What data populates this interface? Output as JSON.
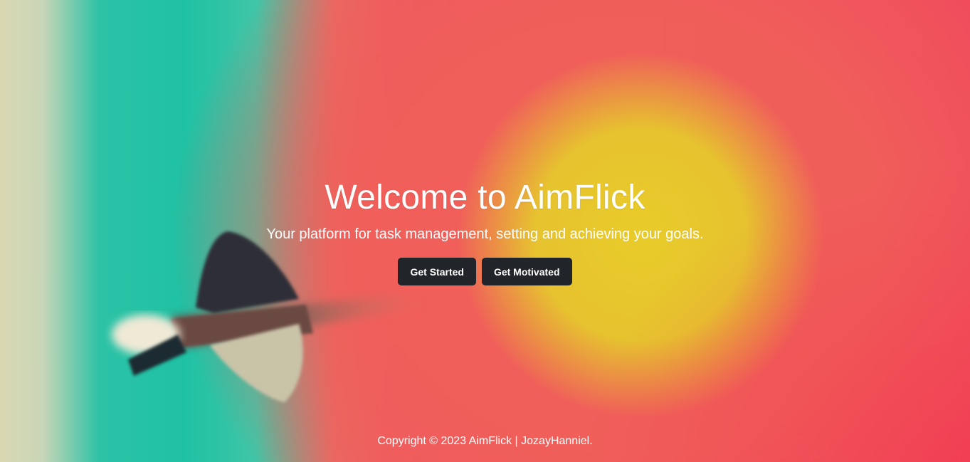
{
  "hero": {
    "title": "Welcome to AimFlick",
    "subtitle": "Your platform for task management, setting and achieving your goals.",
    "buttons": [
      {
        "label": "Get Started"
      },
      {
        "label": "Get Motivated"
      }
    ],
    "background_image": "blurred archery target with dart",
    "button_color": "#212529"
  },
  "footer": {
    "copyright": "Copyright © 2023 AimFlick | JozayHanniel."
  },
  "colors": {
    "target_yellow": "#e7cb2e",
    "target_red": "#f04a5c",
    "target_teal": "#1fc1a4",
    "text": "#ffffff"
  }
}
